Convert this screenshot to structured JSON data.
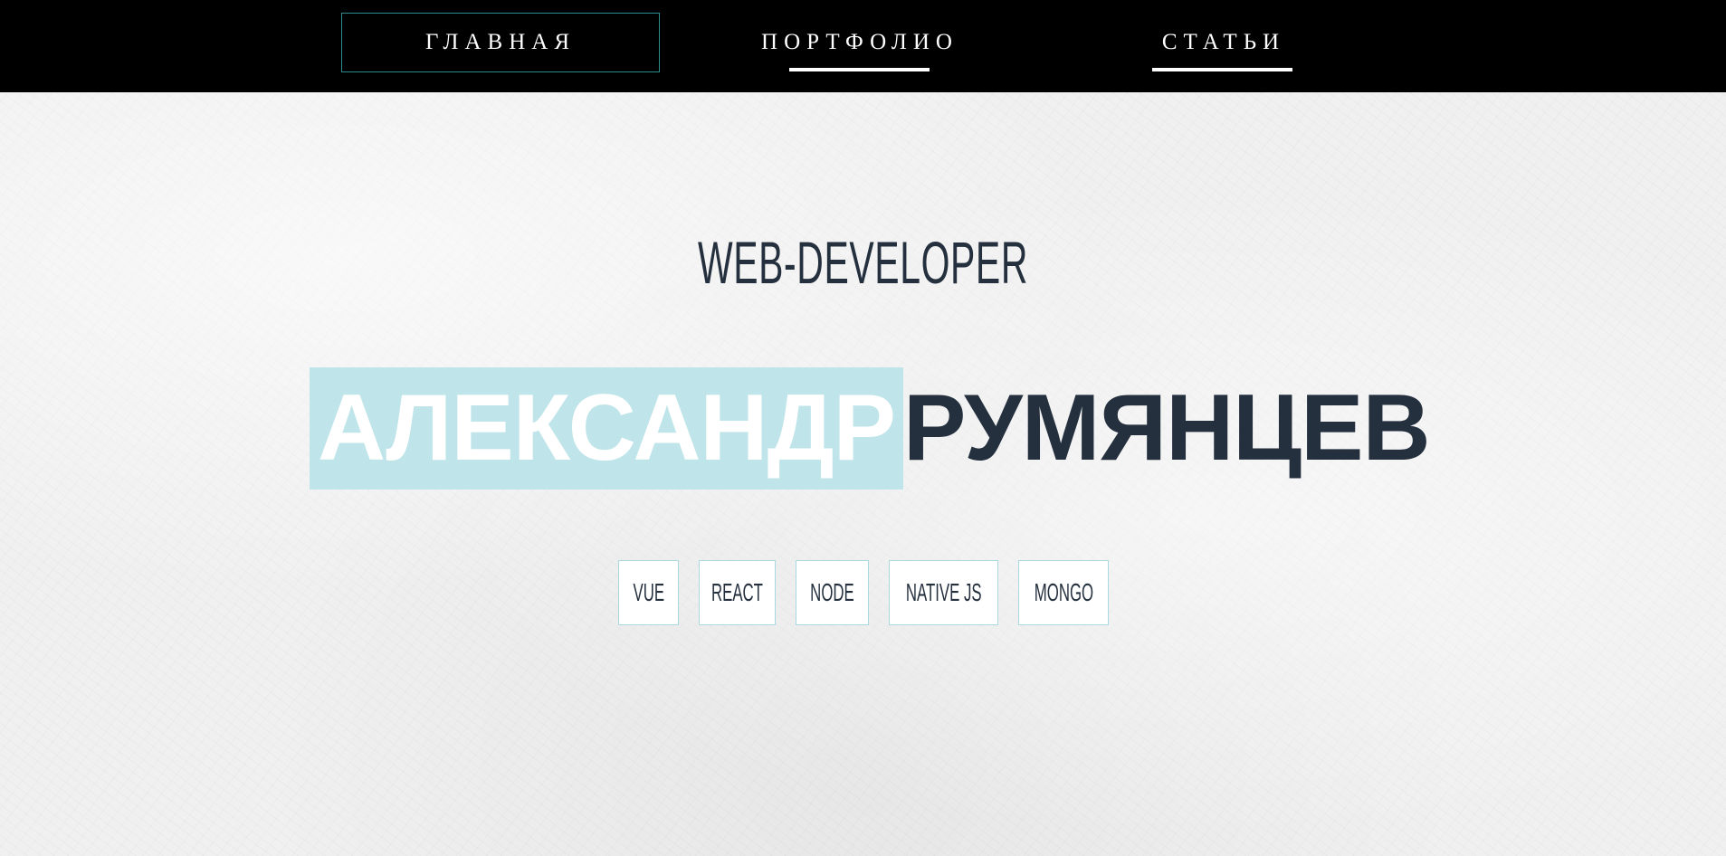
{
  "nav": {
    "items": [
      {
        "label": "ГЛАВНАЯ",
        "active": true
      },
      {
        "label": "ПОРТФОЛИО",
        "active": false
      },
      {
        "label": "СТАТЬИ",
        "active": false
      }
    ]
  },
  "hero": {
    "role": "WEB-DEVELOPER",
    "first_name": "АЛЕКСАНДР",
    "last_name": "РУМЯНЦЕВ"
  },
  "skills": [
    "VUE",
    "REACT",
    "NODE",
    "NATIVE JS",
    "MONGO"
  ],
  "colors": {
    "nav_background": "#000000",
    "nav_text": "#ffffff",
    "active_border": "#2a8c8c",
    "text_dark": "#25303f",
    "highlight": "#bfe5ea",
    "tag_border": "#a9d9de"
  }
}
